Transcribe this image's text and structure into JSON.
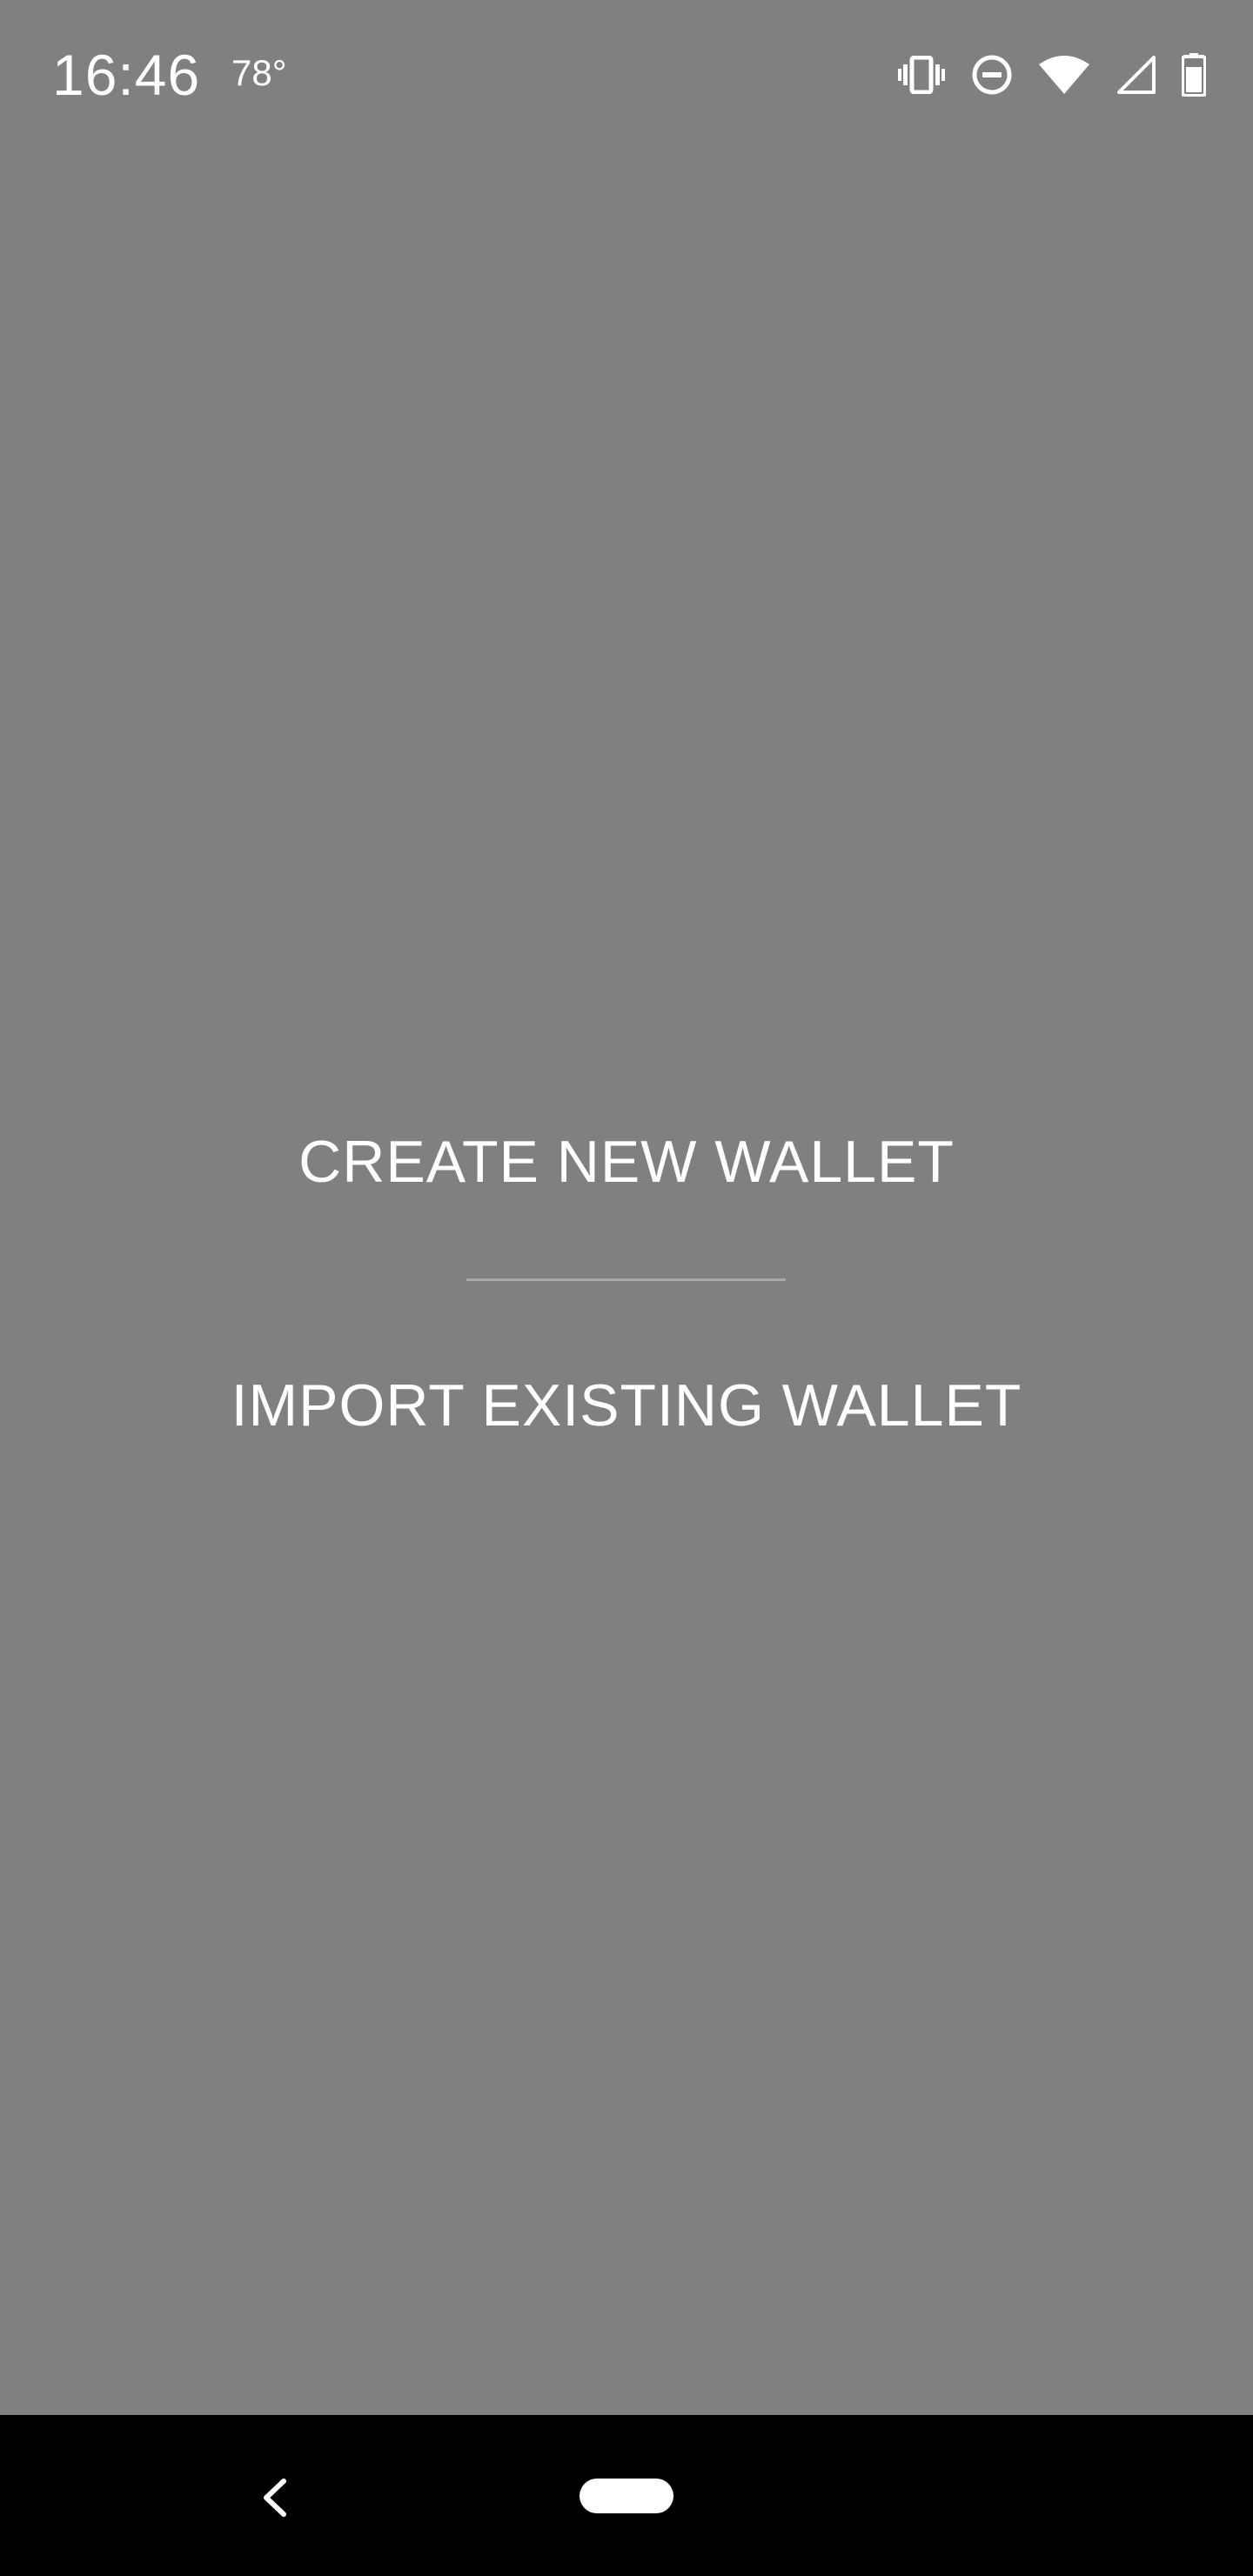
{
  "status_bar": {
    "time": "16:46",
    "temperature": "78°",
    "icons": [
      "vibrate-icon",
      "do-not-disturb-icon",
      "wifi-icon",
      "cellular-signal-icon",
      "battery-icon"
    ]
  },
  "menu": {
    "create_label": "CREATE NEW WALLET",
    "import_label": "IMPORT EXISTING WALLET"
  },
  "nav_bar": {
    "icons": [
      "back-icon",
      "home-pill"
    ]
  },
  "colors": {
    "background": "#808080",
    "text": "#ffffff",
    "divider": "#a8a8a8",
    "nav_bar": "#000000"
  }
}
